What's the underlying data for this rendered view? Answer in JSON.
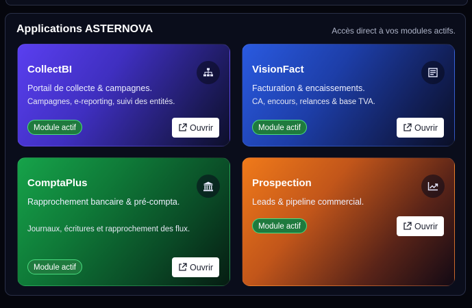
{
  "panel": {
    "title": "Applications ASTERNOVA",
    "subtitle": "Accès direct à vos modules actifs."
  },
  "cards": [
    {
      "title": "CollectBI",
      "description": "Portail de collecte & campagnes.",
      "detail": "Campagnes, e-reporting, suivi des entités.",
      "badge": "Module actif",
      "button": "Ouvrir",
      "icon": "sitemap-icon"
    },
    {
      "title": "VisionFact",
      "description": "Facturation & encaissements.",
      "detail": "CA, encours, relances & base TVA.",
      "badge": "Module actif",
      "button": "Ouvrir",
      "icon": "invoice-icon"
    },
    {
      "title": "ComptaPlus",
      "description": "Rapprochement bancaire & pré-compta.",
      "detail": "Journaux, écritures et rapprochement des flux.",
      "badge": "Module actif",
      "button": "Ouvrir",
      "icon": "bank-icon"
    },
    {
      "title": "Prospection",
      "description": "Leads & pipeline commercial.",
      "badge": "Module actif",
      "button": "Ouvrir",
      "icon": "trend-chart-icon"
    }
  ]
}
